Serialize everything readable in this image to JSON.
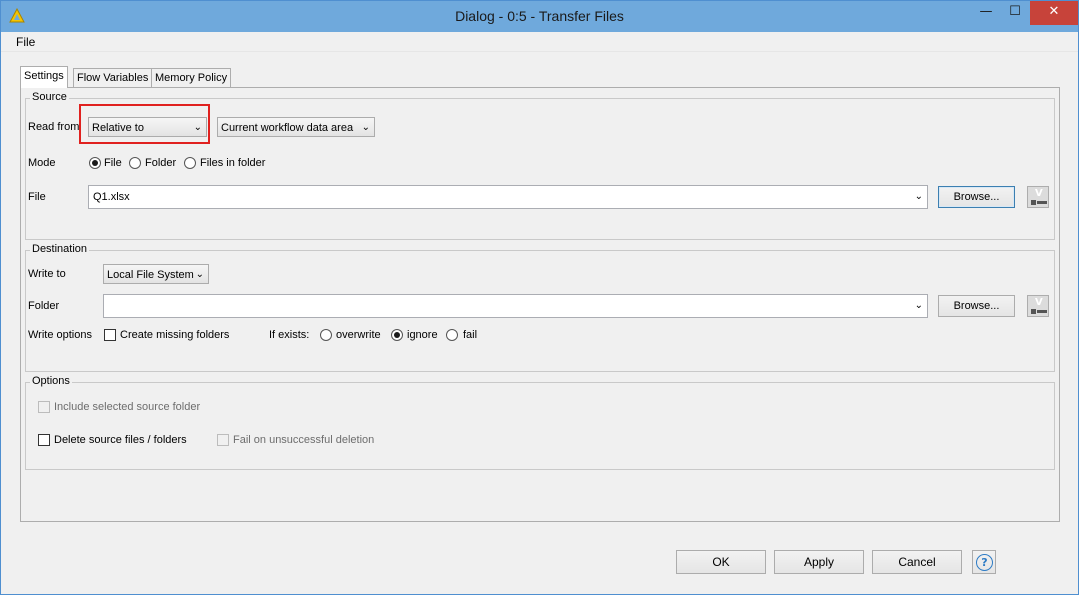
{
  "window": {
    "title": "Dialog - 0:5 - Transfer Files",
    "minimize": "—",
    "maximize": "☐",
    "close": "✕"
  },
  "menu": {
    "file": "File"
  },
  "tabs": [
    {
      "label": "Settings",
      "active": true
    },
    {
      "label": "Flow Variables",
      "active": false
    },
    {
      "label": "Memory Policy",
      "active": false
    }
  ],
  "source": {
    "title": "Source",
    "read_from_label": "Read from",
    "read_from_value": "Relative to",
    "relative_value": "Current workflow data area",
    "mode_label": "Mode",
    "mode_options": [
      "File",
      "Folder",
      "Files in folder"
    ],
    "mode_selected": "File",
    "file_label": "File",
    "file_value": "Q1.xlsx",
    "browse_label": "Browse..."
  },
  "destination": {
    "title": "Destination",
    "write_to_label": "Write to",
    "write_to_value": "Local File System",
    "folder_label": "Folder",
    "folder_value": "",
    "browse_label": "Browse...",
    "write_options_label": "Write options",
    "create_missing_folders": "Create missing folders",
    "if_exists_label": "If exists:",
    "if_exists_options": [
      "overwrite",
      "ignore",
      "fail"
    ],
    "if_exists_selected": "ignore"
  },
  "options": {
    "title": "Options",
    "include_source_folder": "Include selected source folder",
    "delete_source": "Delete source files / folders",
    "fail_on_deletion": "Fail on unsuccessful deletion"
  },
  "buttons": {
    "ok": "OK",
    "apply": "Apply",
    "cancel": "Cancel",
    "help": "?"
  },
  "icons": {
    "flow_variable": "V",
    "chevron": "⌄"
  },
  "colors": {
    "titlebar": "#6fa9dc",
    "close": "#c7433a",
    "highlight": "#e0211f"
  }
}
